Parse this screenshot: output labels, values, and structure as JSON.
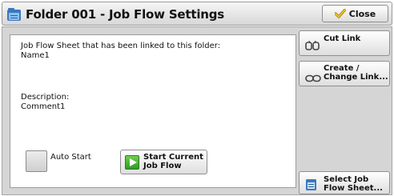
{
  "header": {
    "title": "Folder 001 - Job Flow Settings",
    "close_label": "Close",
    "title_icon": "folder-icon",
    "close_icon": "checkmark-icon"
  },
  "info": {
    "linked_label": "Job Flow Sheet that has been linked to this folder:",
    "linked_value": "Name1",
    "description_label": "Description:",
    "description_value": "Comment1"
  },
  "controls": {
    "auto_start_label": "Auto Start",
    "auto_start_checked": false,
    "start_label": "Start Current\nJob Flow",
    "start_icon": "play-icon"
  },
  "side": {
    "cut_link_label": "Cut Link",
    "cut_link_icon": "broken-link-icon",
    "create_label": "Create /\nChange Link...",
    "create_icon": "chain-link-icon",
    "select_label": "Select Job\nFlow Sheet...",
    "select_icon": "flow-sheet-icon"
  },
  "colors": {
    "panel_bg": "#d5d5d5",
    "play_green": "#3aa52e",
    "folder_blue": "#3a78c0"
  }
}
